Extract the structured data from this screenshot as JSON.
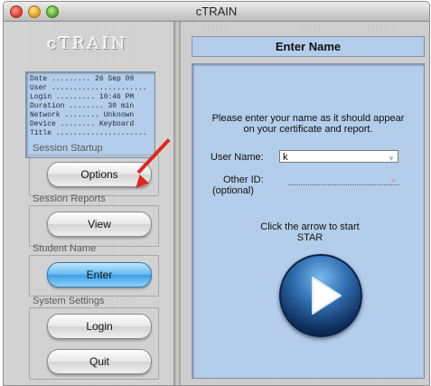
{
  "window": {
    "title": "cTRAIN"
  },
  "sidebar": {
    "logo": "cTRAIN",
    "info": [
      "Date ......... 26 Sep 09",
      "User ......................",
      "Login ......... 10:46 PM",
      "Duration ........ 30 min",
      "Network ........ Unknown",
      "Device ........ Keyboard",
      "Title ....................."
    ],
    "groups": {
      "session_startup": "Session Startup",
      "session_reports": "Session Reports",
      "student_name": "Student Name",
      "system_settings": "System Settings"
    },
    "buttons": {
      "options": "Options",
      "view": "View",
      "enter": "Enter",
      "login": "Login",
      "quit": "Quit"
    }
  },
  "main": {
    "header": "Enter Name",
    "prompt": "Please enter your name as it should appear on your certificate and report.",
    "user_name_label": "User Name:",
    "user_name_value": "k",
    "other_id_label": "Other ID:",
    "optional_label": "(optional)",
    "click_message": "Click the arrow to start STAR"
  },
  "colors": {
    "panel_blue": "#b4cdea",
    "enter_button_blue": "#3d9fe2",
    "annotation_arrow": "#e1261b",
    "play_button": "#1a4a86"
  },
  "icons": [
    "close-icon",
    "minimize-icon",
    "zoom-icon",
    "play-icon",
    "chevron-down-icon",
    "red-arrow-icon"
  ]
}
